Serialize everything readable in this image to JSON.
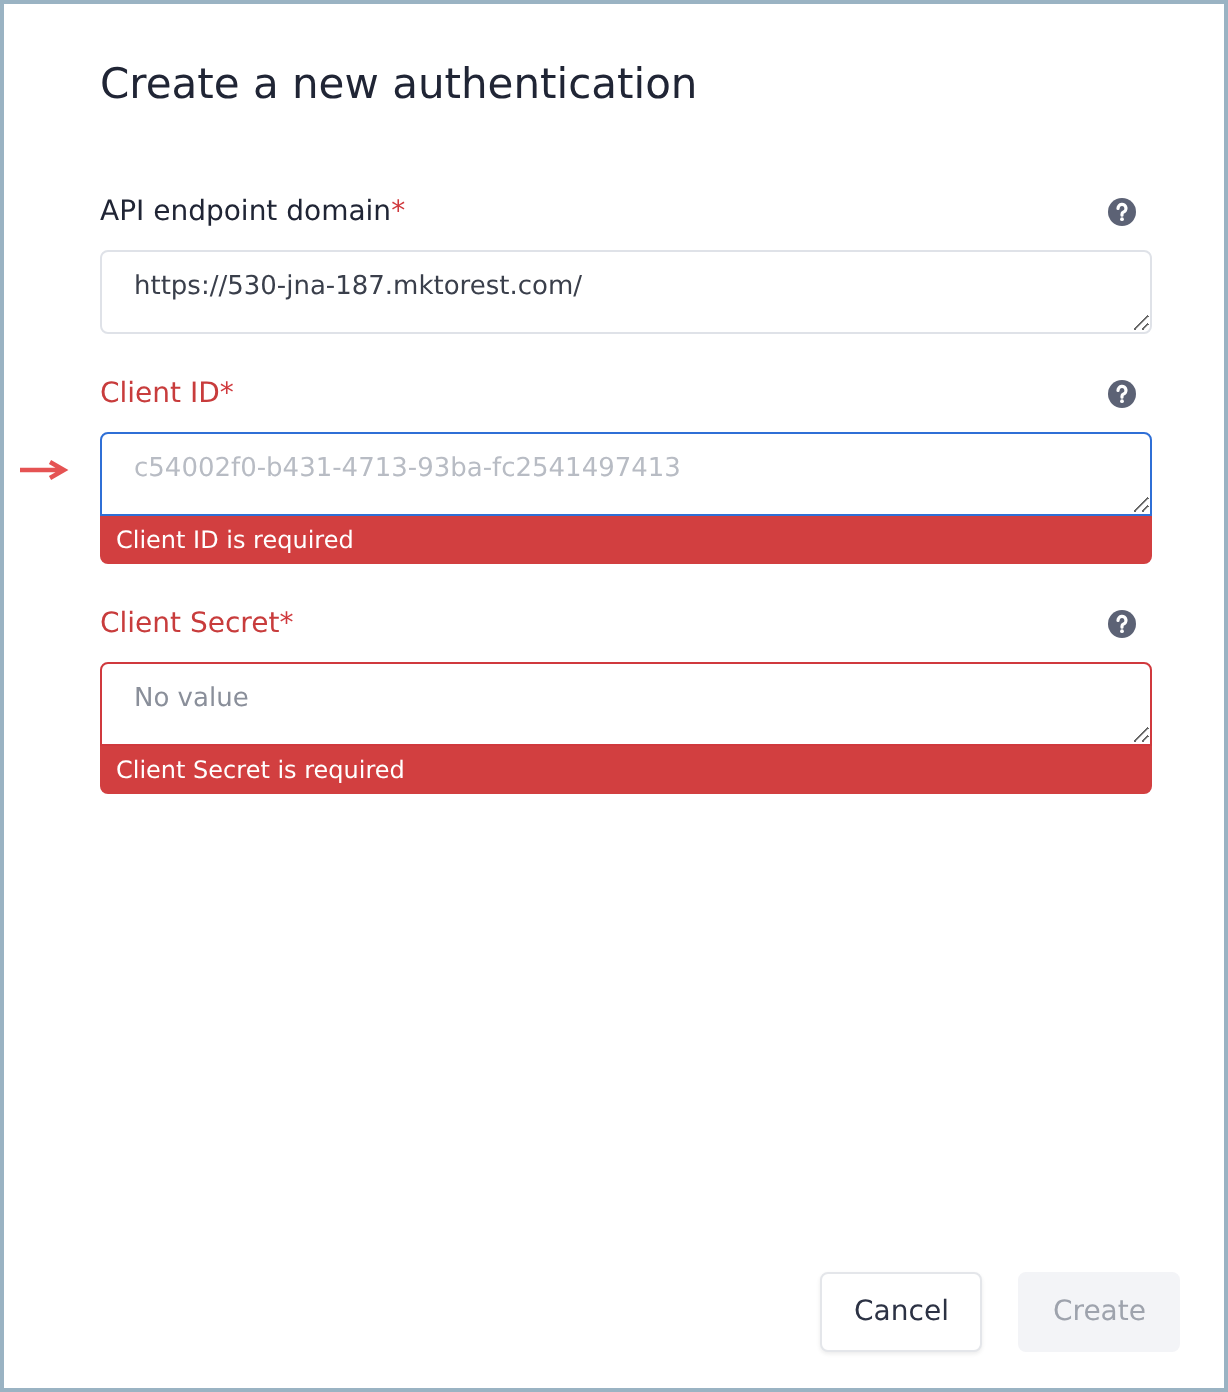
{
  "dialog": {
    "title": "Create a new authentication"
  },
  "fields": [
    {
      "label": "API endpoint domain",
      "required": true,
      "required_mark": "*",
      "invalid": false,
      "focused": false,
      "pointed": false,
      "redacted": false,
      "value": "https://530-jna-187.mktorest.com/"
    },
    {
      "label": "Client ID",
      "required": true,
      "required_mark": "*",
      "invalid": true,
      "focused": true,
      "pointed": true,
      "redacted": true,
      "value": "c54002f0-b431-4713-93ba-fc2541497413",
      "error": "Client ID is required"
    },
    {
      "label": "Client Secret",
      "required": true,
      "required_mark": "*",
      "invalid": true,
      "focused": false,
      "pointed": false,
      "redacted": false,
      "placeholder": "No value",
      "error": "Client Secret is required"
    }
  ],
  "buttons": [
    {
      "label": "Cancel",
      "disabled": false
    },
    {
      "label": "Create",
      "disabled": true
    }
  ]
}
